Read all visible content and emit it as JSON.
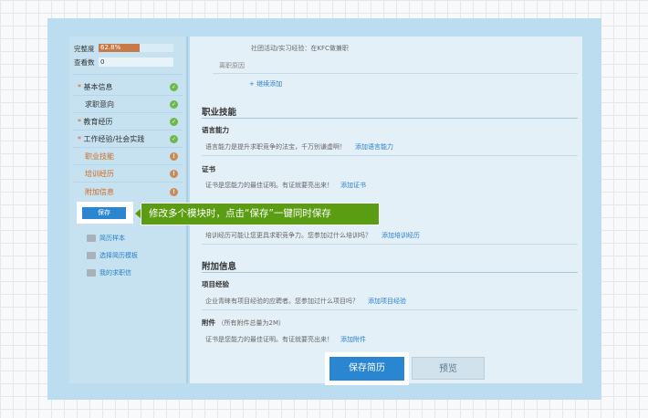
{
  "sidebar": {
    "completeness_label": "完整度",
    "completeness_value": "62.8%",
    "completeness_fraction": 0.55,
    "views_label": "查看数",
    "views_value": "0",
    "required_mark": "*",
    "items": [
      {
        "label": "基本信息",
        "required": true,
        "status": "complete"
      },
      {
        "label": "求职意向",
        "required": false,
        "status": "complete"
      },
      {
        "label": "教育经历",
        "required": true,
        "status": "complete"
      },
      {
        "label": "工作经验/社会实践",
        "required": true,
        "status": "complete"
      },
      {
        "label": "职业技能",
        "required": false,
        "status": "incomplete"
      },
      {
        "label": "培训经历",
        "required": false,
        "status": "incomplete"
      },
      {
        "label": "附加信息",
        "required": false,
        "status": "incomplete"
      }
    ],
    "save_label": "保存",
    "tools": [
      {
        "label": "简历样本",
        "icon": "document-icon"
      },
      {
        "label": "选择简历模板",
        "icon": "template-icon"
      },
      {
        "label": "我的求职信",
        "icon": "letter-icon"
      }
    ]
  },
  "tooltip": {
    "text": "修改多个模块时，点击“保存”一键同时保存"
  },
  "main": {
    "experience": {
      "line1": "社团活动/实习经验：在KFC做兼职",
      "reason_label": "离职原因",
      "add_more": "继续添加"
    },
    "skills": {
      "title": "职业技能",
      "language": {
        "title": "语言能力",
        "desc": "语言能力是提升求职竞争的法宝，千万别谦虚啊！",
        "add": "添加语言能力"
      },
      "certificate": {
        "title": "证书",
        "desc": "证书是您能力的最佳证明。有证就要亮出来！",
        "add": "添加证书"
      }
    },
    "training": {
      "desc": "培训经历可能让您更具求职竞争力。您参加过什么培训吗？",
      "add": "添加培训经历"
    },
    "extra": {
      "title": "附加信息",
      "project": {
        "title": "项目经验",
        "desc": "企业青睐有项目经验的应聘者。您参加过什么项目吗？",
        "add": "添加项目经验"
      },
      "attachment": {
        "title": "附件",
        "note": "（所有附件总量为2M）",
        "desc": "证书是您能力的最佳证明。有证就要亮出来！",
        "add": "添加附件"
      }
    },
    "save_resume": "保存简历",
    "preview": "预览"
  },
  "icons": {
    "complete": "check-circle-icon",
    "incomplete": "exclamation-circle-icon",
    "add": "plus-icon"
  },
  "colors": {
    "primary": "#2a86d0",
    "tooltip": "#5a9c12",
    "progress": "#c87a46",
    "complete": "#6cb84a",
    "incomplete": "#cc8a5a",
    "link": "#2a7fc8",
    "warning_text": "#d06a20"
  }
}
